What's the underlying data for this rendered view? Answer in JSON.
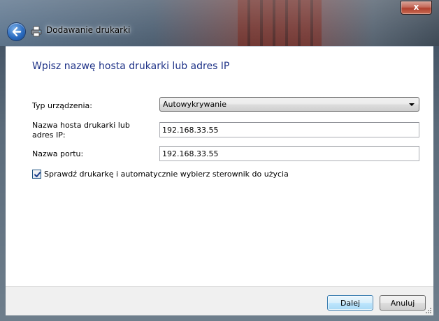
{
  "window": {
    "title": "Dodawanie drukarki",
    "close_glyph": "x"
  },
  "page": {
    "heading": "Wpisz nazwę hosta drukarki lub adres IP"
  },
  "form": {
    "device_type": {
      "label": "Typ urządzenia:",
      "selected": "Autowykrywanie"
    },
    "host": {
      "label": "Nazwa hosta drukarki lub adres IP:",
      "value": "192.168.33.55"
    },
    "port": {
      "label": "Nazwa portu:",
      "value": "192.168.33.55"
    },
    "query_printer": {
      "label": "Sprawdź drukarkę i automatycznie wybierz sterownik do użycia",
      "checked": true
    }
  },
  "footer": {
    "next_label": "Dalej",
    "cancel_label": "Anuluj"
  },
  "colors": {
    "heading": "#1e3287",
    "close_button": "#c56a5a",
    "default_button_border": "#3c7fb1"
  },
  "icons": {
    "back": "back-arrow-icon",
    "title": "printer-icon",
    "close": "close-icon",
    "dropdown": "chevron-down-icon",
    "check": "checkmark-icon"
  }
}
